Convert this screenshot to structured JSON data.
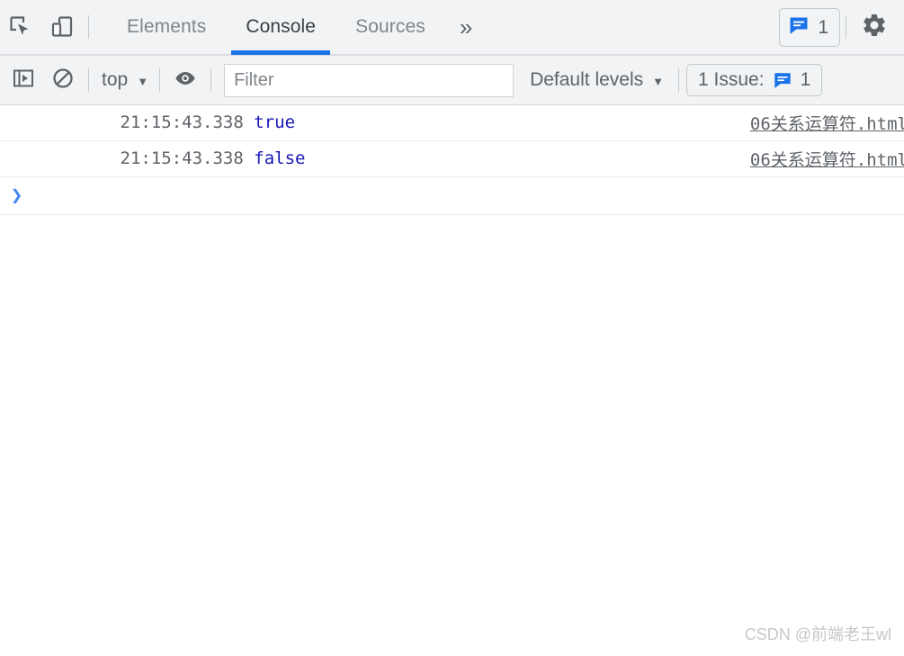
{
  "tabbar": {
    "inspect_icon": "inspect-element-icon",
    "device_icon": "device-toolbar-icon",
    "tabs": [
      {
        "label": "Elements",
        "active": false
      },
      {
        "label": "Console",
        "active": true
      },
      {
        "label": "Sources",
        "active": false
      }
    ],
    "more_tabs_label": "»",
    "message_badge": {
      "icon": "message-bubble-icon",
      "count": "1"
    },
    "settings_icon": "gear-icon"
  },
  "console_toolbar": {
    "sidebar_icon": "console-sidebar-icon",
    "clear_icon": "clear-console-icon",
    "context": {
      "label": "top",
      "caret": "▼"
    },
    "eye_icon": "live-expression-eye-icon",
    "filter": {
      "value": "",
      "placeholder": "Filter"
    },
    "levels": {
      "label": "Default levels",
      "caret": "▼"
    },
    "issues": {
      "label": "1 Issue:",
      "icon": "message-bubble-icon",
      "count": "1"
    }
  },
  "console_body": {
    "logs": [
      {
        "timestamp": "21:15:43.338",
        "value": "true",
        "source": "06关系运算符.html"
      },
      {
        "timestamp": "21:15:43.338",
        "value": "false",
        "source": "06关系运算符.html"
      }
    ],
    "prompt_arrow": "❯",
    "prompt_value": ""
  },
  "watermark": {
    "text": "CSDN @前端老王wl"
  },
  "colors": {
    "accent_blue": "#1a73e8",
    "prompt_blue": "#4285f4",
    "log_value_blue": "#1616b8",
    "toolbar_bg": "#f1f3f4",
    "text_gray": "#5f6368"
  }
}
